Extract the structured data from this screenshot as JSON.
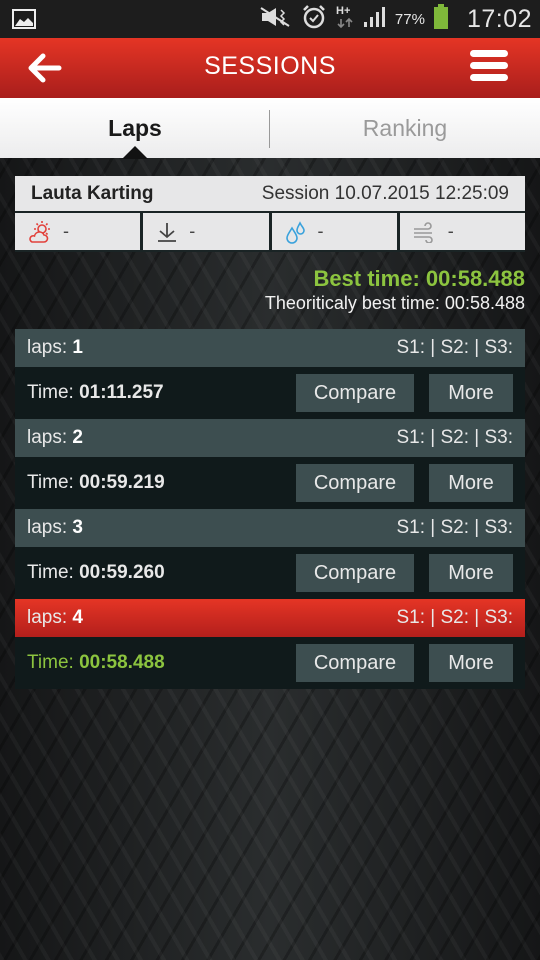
{
  "status_bar": {
    "time": "17:02",
    "battery_percent": "77%",
    "network_type": "H+",
    "icons": [
      "image-notification-icon",
      "mute-icon",
      "alarm-icon",
      "hplus-data-icon",
      "signal-icon",
      "battery-icon"
    ]
  },
  "app_bar": {
    "title": "SESSIONS",
    "back_icon": "arrow-left-icon",
    "menu_icon": "hamburger-menu-icon"
  },
  "tabs": [
    {
      "label": "Laps",
      "active": true
    },
    {
      "label": "Ranking",
      "active": false
    }
  ],
  "session": {
    "track": "Lauta Karting",
    "date_label": "Session 10.07.2015 12:25:09",
    "conditions": [
      {
        "icon": "weather-sun-cloud-icon",
        "value": "-"
      },
      {
        "icon": "pressure-down-arrow-icon",
        "value": "-"
      },
      {
        "icon": "humidity-drops-icon",
        "value": "-"
      },
      {
        "icon": "wind-icon",
        "value": "-"
      }
    ]
  },
  "summary": {
    "best_time": "Best time: 00:58.488",
    "theoretical_best": "Theoriticaly best time: 00:58.488"
  },
  "colors": {
    "accent_red": "#e53525",
    "best_green": "#8cc43f",
    "lap_header": "#3d4e50",
    "lap_body": "#101a1b"
  },
  "laps": [
    {
      "label": "laps:",
      "number": "1",
      "sectors": "S1: | S2: | S3:",
      "time_label": "Time:",
      "time": "01:11.257",
      "best": false,
      "compare": "Compare",
      "more": "More"
    },
    {
      "label": "laps:",
      "number": "2",
      "sectors": "S1: | S2: | S3:",
      "time_label": "Time:",
      "time": "00:59.219",
      "best": false,
      "compare": "Compare",
      "more": "More"
    },
    {
      "label": "laps:",
      "number": "3",
      "sectors": "S1: | S2: | S3:",
      "time_label": "Time:",
      "time": "00:59.260",
      "best": false,
      "compare": "Compare",
      "more": "More"
    },
    {
      "label": "laps:",
      "number": "4",
      "sectors": "S1: | S2: | S3:",
      "time_label": "Time:",
      "time": "00:58.488",
      "best": true,
      "compare": "Compare",
      "more": "More"
    }
  ]
}
